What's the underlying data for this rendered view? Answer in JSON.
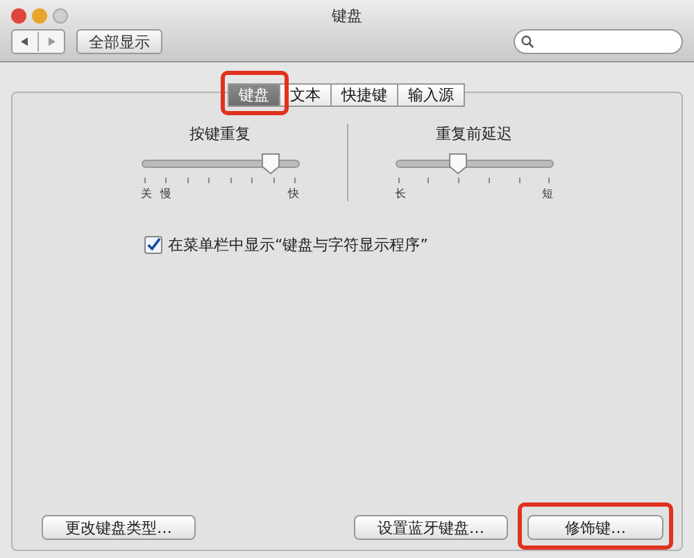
{
  "window": {
    "title": "键盘"
  },
  "toolbar": {
    "show_all": "全部显示"
  },
  "tabs": [
    {
      "label": "键盘",
      "selected": true,
      "highlighted": true
    },
    {
      "label": "文本",
      "selected": false,
      "highlighted": false
    },
    {
      "label": "快捷键",
      "selected": false,
      "highlighted": false
    },
    {
      "label": "输入源",
      "selected": false,
      "highlighted": false
    }
  ],
  "sliders": [
    {
      "title": "按键重复",
      "level": 0.82,
      "labels_start": [
        "关",
        "慢"
      ],
      "labels_end": [
        "快"
      ]
    },
    {
      "title": "重复前延迟",
      "level": 0.4,
      "labels_start": [
        "长"
      ],
      "labels_end": [
        "短"
      ]
    }
  ],
  "checkbox": {
    "label": "在菜单栏中显示“键盘与字符显示程序”",
    "checked": true
  },
  "buttons": [
    {
      "label": "更改键盘类型…",
      "highlighted": false
    },
    {
      "label": "设置蓝牙键盘…",
      "highlighted": false
    },
    {
      "label": "修饰键…",
      "highlighted": true
    }
  ]
}
